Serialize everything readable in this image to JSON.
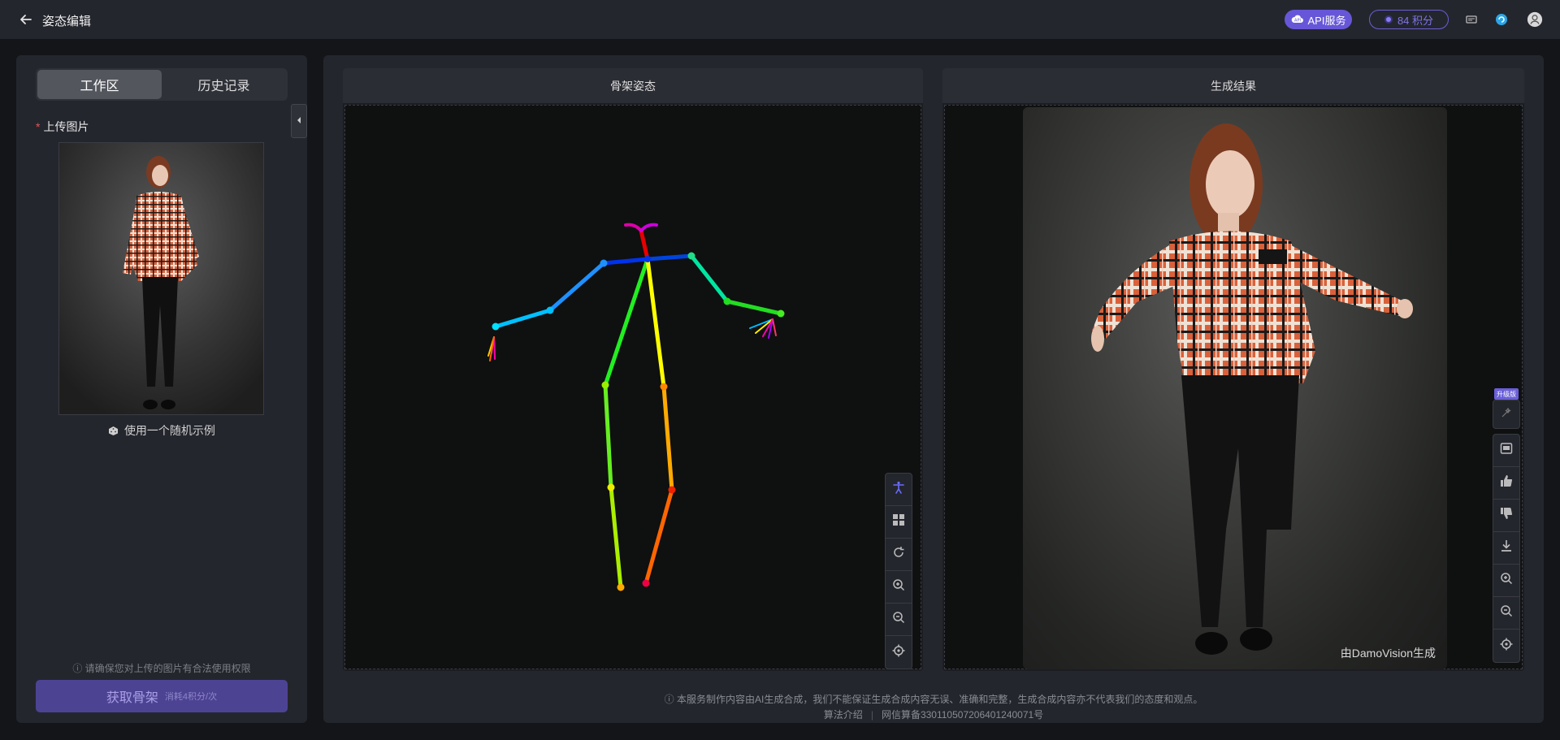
{
  "header": {
    "title": "姿态编辑",
    "api_label": "API服务",
    "points_label": "84 积分"
  },
  "left": {
    "tabs": [
      {
        "label": "工作区",
        "active": true
      },
      {
        "label": "历史记录",
        "active": false
      }
    ],
    "upload_label": "上传图片",
    "required_mark": "*",
    "random_example": "使用一个随机示例",
    "rights_notice": "请确保您对上传的图片有合法使用权限",
    "submit_label": "获取骨架",
    "submit_cost": "消耗4积分/次"
  },
  "skeleton_card": {
    "title": "骨架姿态"
  },
  "result_card": {
    "title": "生成结果",
    "watermark": "由DamoVision生成",
    "upgrade_badge": "升级版"
  },
  "footer": {
    "disclaimer": "本服务制作内容由AI生成合成，我们不能保证生成合成内容无误、准确和完整，生成合成内容亦不代表我们的态度和观点。",
    "algo_link": "算法介绍",
    "license": "网信算备330110507206401240071号"
  },
  "colors": {
    "accent": "#6757d8",
    "panel": "#24262e",
    "background": "#141519"
  }
}
